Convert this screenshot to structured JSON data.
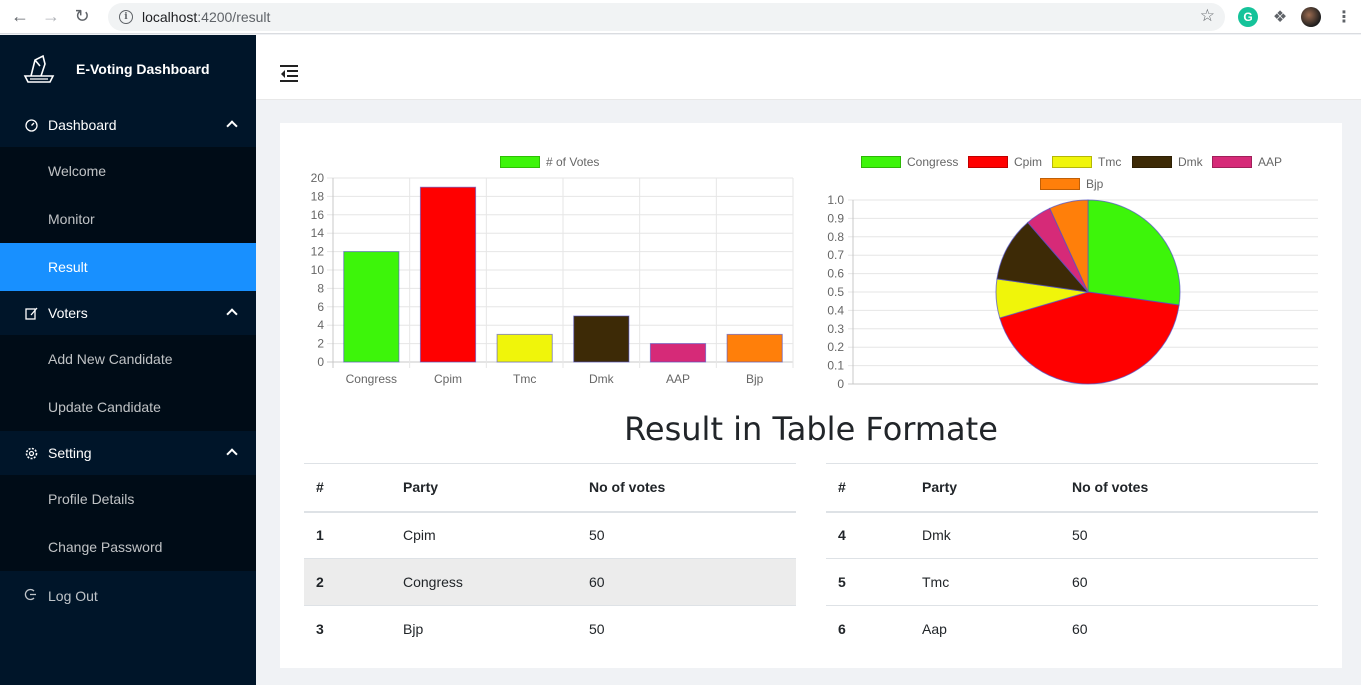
{
  "browser": {
    "url_host": "localhost",
    "url_path": ":4200/result"
  },
  "sidebar": {
    "brand": "E-Voting Dashboard",
    "groups": [
      {
        "label": "Dashboard",
        "icon": "dashboard-icon",
        "items": [
          "Welcome",
          "Monitor",
          "Result"
        ]
      },
      {
        "label": "Voters",
        "icon": "edit-icon",
        "items": [
          "Add New Candidate",
          "Update Candidate"
        ]
      },
      {
        "label": "Setting",
        "icon": "gear-icon",
        "items": [
          "Profile Details",
          "Change Password"
        ]
      }
    ],
    "active_item": "Result",
    "logout": "Log Out"
  },
  "colors": {
    "sidebar_bg": "#001529",
    "active": "#1890ff",
    "congress": "#3df50a",
    "cpim": "#ff0000",
    "tmc": "#f0f50a",
    "dmk": "#3d2a06",
    "aap": "#d62a78",
    "bjp": "#ff7f0a"
  },
  "chart_data": [
    {
      "type": "bar",
      "legend": [
        "# of Votes"
      ],
      "categories": [
        "Congress",
        "Cpim",
        "Tmc",
        "Dmk",
        "AAP",
        "Bjp"
      ],
      "series": [
        {
          "name": "# of Votes",
          "values": [
            12,
            19,
            3,
            5,
            2,
            3
          ]
        }
      ],
      "ylim": [
        0,
        20
      ],
      "yticks": [
        0,
        2,
        4,
        6,
        8,
        10,
        12,
        14,
        16,
        18,
        20
      ],
      "grid": true,
      "legend_position": "top"
    },
    {
      "type": "pie",
      "legend": [
        "Congress",
        "Cpim",
        "Tmc",
        "Dmk",
        "AAP",
        "Bjp"
      ],
      "values": [
        12,
        19,
        3,
        5,
        2,
        3
      ],
      "yticks": [
        "0",
        "0.1",
        "0.2",
        "0.3",
        "0.4",
        "0.5",
        "0.6",
        "0.7",
        "0.8",
        "0.9",
        "1.0"
      ],
      "grid": true,
      "legend_position": "top"
    }
  ],
  "result": {
    "title": "Result in Table Formate",
    "headers": [
      "#",
      "Party",
      "No of votes"
    ],
    "left_rows": [
      {
        "idx": "1",
        "party": "Cpim",
        "votes": "50"
      },
      {
        "idx": "2",
        "party": "Congress",
        "votes": "60"
      },
      {
        "idx": "3",
        "party": "Bjp",
        "votes": "50"
      }
    ],
    "right_rows": [
      {
        "idx": "4",
        "party": "Dmk",
        "votes": "50"
      },
      {
        "idx": "5",
        "party": "Tmc",
        "votes": "60"
      },
      {
        "idx": "6",
        "party": "Aap",
        "votes": "60"
      }
    ]
  }
}
